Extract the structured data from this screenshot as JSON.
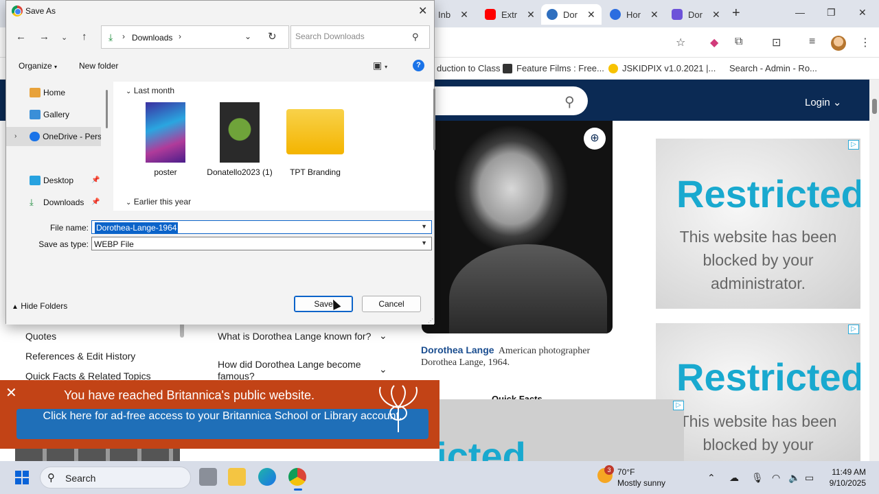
{
  "browser": {
    "tabs": [
      {
        "label": "Inb",
        "color": "#e0e0e0"
      },
      {
        "label": "Extr",
        "color": "#ff0000"
      },
      {
        "label": "Dor",
        "color": "#2f6fbf"
      },
      {
        "label": "Hor",
        "color": "#2b6de0"
      },
      {
        "label": "Dor",
        "color": "#6d52d9"
      }
    ],
    "bookmarks": [
      {
        "label": "duction to Class",
        "color": "#ffffff"
      },
      {
        "label": "Feature Films : Free...",
        "color": "#333333"
      },
      {
        "label": "JSKIDPIX v1.0.2021 |...",
        "color": "#f7c200"
      },
      {
        "label": "Search - Admin - Ro...",
        "color": "#ffffff"
      }
    ]
  },
  "page": {
    "login": "Login",
    "caption_name": "Dorothea Lange",
    "caption_text": "American photographer Dorothea Lange, 1964.",
    "quick_facts": "Quick Facts",
    "nav_items": [
      "Quotes",
      "References & Edit History",
      "Quick Facts & Related Topics"
    ],
    "faq": [
      "What is Dorothea Lange known for?",
      "How did Dorothea Lange become famous?"
    ],
    "ads": [
      {
        "title": "Restricted",
        "message": "This website has been blocked by your administrator."
      },
      {
        "title": "Restricted",
        "message": "This website has been blocked by your"
      }
    ],
    "bottom_ad_title": "Restricted",
    "banner": {
      "title": "You have reached Britannica's public website.",
      "cta": "Click here for ad-free access to your Britannica School or Library account."
    }
  },
  "dialog": {
    "title": "Save As",
    "breadcrumb": "Downloads",
    "search_placeholder": "Search Downloads",
    "organize": "Organize",
    "new_folder": "New folder",
    "nav_pane": [
      {
        "label": "Home",
        "color": "#e8a23a"
      },
      {
        "label": "Gallery",
        "color": "#3a8fd8"
      },
      {
        "label": "OneDrive - Perso",
        "color": "#1a73e8"
      },
      {
        "label": "Desktop",
        "color": "#27a2e0"
      },
      {
        "label": "Downloads",
        "color": "#1a8a3a"
      }
    ],
    "groups": [
      "Last month",
      "Earlier this year"
    ],
    "files": [
      {
        "name": "poster"
      },
      {
        "name": "Donatello2023 (1)"
      },
      {
        "name": "TPT Branding"
      }
    ],
    "file_name_label": "File name:",
    "file_name_value": "Dorothea-Lange-1964",
    "save_type_label": "Save as type:",
    "save_type_value": "WEBP File",
    "hide_folders": "Hide Folders",
    "save": "Save",
    "cancel": "Cancel"
  },
  "taskbar": {
    "search": "Search",
    "weather_badge": "3",
    "temp": "70°F",
    "condition": "Mostly sunny",
    "time": "11:49 AM",
    "date": "9/10/2025"
  }
}
